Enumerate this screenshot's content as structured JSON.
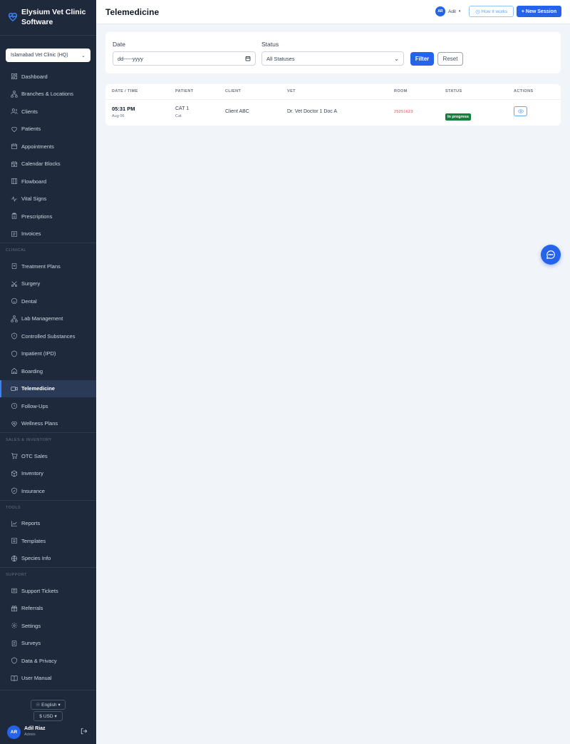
{
  "app": {
    "name_line1": "Elysium Vet Clinic",
    "name_line2": "Software"
  },
  "clinic_selector": {
    "value": "Islamabad Vet Clinic (HQ)"
  },
  "nav": {
    "main": [
      {
        "label": "Dashboard",
        "icon": "dashboard-icon"
      },
      {
        "label": "Branches & Locations",
        "icon": "branches-icon"
      },
      {
        "label": "Clients",
        "icon": "users-icon"
      },
      {
        "label": "Patients",
        "icon": "heart-icon"
      },
      {
        "label": "Appointments",
        "icon": "calendar-icon"
      },
      {
        "label": "Calendar Blocks",
        "icon": "calendar-block-icon"
      },
      {
        "label": "Flowboard",
        "icon": "board-icon"
      },
      {
        "label": "Vital Signs",
        "icon": "pulse-icon"
      },
      {
        "label": "Prescriptions",
        "icon": "clipboard-icon"
      },
      {
        "label": "Invoices",
        "icon": "invoice-icon"
      }
    ],
    "clinical_label": "CLINICAL",
    "clinical": [
      {
        "label": "Treatment Plans",
        "icon": "plan-icon"
      },
      {
        "label": "Surgery",
        "icon": "scissors-icon"
      },
      {
        "label": "Dental",
        "icon": "smile-icon"
      },
      {
        "label": "Lab Management",
        "icon": "lab-icon"
      },
      {
        "label": "Controlled Substances",
        "icon": "shield-icon"
      },
      {
        "label": "Inpatient (IPD)",
        "icon": "bed-icon"
      },
      {
        "label": "Boarding",
        "icon": "house-icon"
      },
      {
        "label": "Telemedicine",
        "icon": "video-icon",
        "active": true
      },
      {
        "label": "Follow-Ups",
        "icon": "clock-icon"
      },
      {
        "label": "Wellness Plans",
        "icon": "heart-pulse-icon"
      }
    ],
    "sales_label": "SALES & INVENTORY",
    "sales": [
      {
        "label": "OTC Sales",
        "icon": "cart-icon"
      },
      {
        "label": "Inventory",
        "icon": "box-icon"
      },
      {
        "label": "Insurance",
        "icon": "shield-check-icon"
      }
    ],
    "tools_label": "TOOLS",
    "tools": [
      {
        "label": "Reports",
        "icon": "chart-icon"
      },
      {
        "label": "Templates",
        "icon": "template-icon"
      },
      {
        "label": "Species Info",
        "icon": "globe-icon"
      }
    ],
    "support_label": "SUPPORT",
    "support": [
      {
        "label": "Support Tickets",
        "icon": "ticket-icon"
      },
      {
        "label": "Referrals",
        "icon": "gift-icon"
      },
      {
        "label": "Settings",
        "icon": "gear-icon"
      },
      {
        "label": "Surveys",
        "icon": "survey-icon"
      },
      {
        "label": "Data & Privacy",
        "icon": "privacy-shield-icon"
      },
      {
        "label": "User Manual",
        "icon": "book-icon"
      }
    ]
  },
  "footer": {
    "language": "English",
    "currency": "USD",
    "currency_symbol": "$",
    "user_initials": "AR",
    "user_name": "Adil Riaz",
    "user_role": "Admin"
  },
  "topbar": {
    "title": "Telemedicine",
    "user_initials": "AR",
    "user_name": "Adil",
    "how_it_works": "How it works",
    "new_session": "+ New Session"
  },
  "filters": {
    "date_label": "Date",
    "date_placeholder": "dd-----yyyy",
    "status_label": "Status",
    "status_value": "All Statuses",
    "filter_button": "Filter",
    "reset_button": "Reset"
  },
  "table": {
    "headers": [
      "DATE / TIME",
      "PATIENT",
      "CLIENT",
      "VET",
      "ROOM",
      "STATUS",
      "ACTIONS"
    ],
    "rows": [
      {
        "time": "05:31 PM",
        "date": "Aug 06",
        "patient": "CAT 1",
        "species": "Cat",
        "client": "Client ABC",
        "vet": "Dr. Vet Doctor 1 Doc A",
        "room": "25251623",
        "status": "In progress"
      }
    ]
  },
  "colors": {
    "sidebar_bg": "#1e293b",
    "accent": "#2563eb",
    "status_in_progress": "#15803d",
    "room_text": "#ef4444"
  }
}
